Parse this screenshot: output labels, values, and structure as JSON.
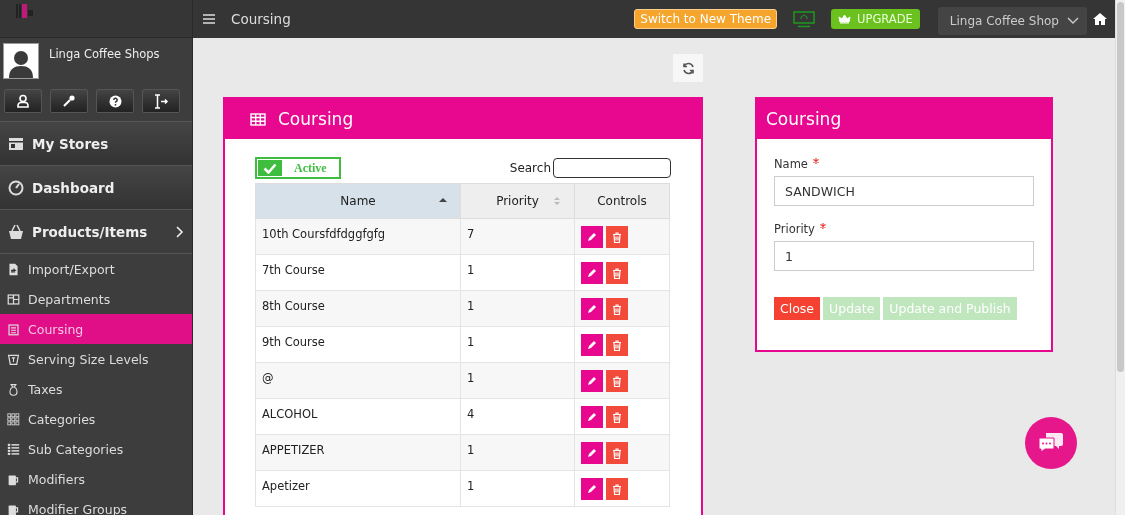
{
  "topbar": {
    "title": "Coursing",
    "theme_button": "Switch to New Theme",
    "upgrade_button": "UPGRADE",
    "store_selector": "Linga Coffee Shop"
  },
  "profile": {
    "name": "Linga Coffee Shops"
  },
  "sidebar": {
    "items": [
      {
        "label": "My Stores",
        "kind": "main",
        "selected": false
      },
      {
        "label": "Dashboard",
        "kind": "main",
        "selected": false
      },
      {
        "label": "Products/Items",
        "kind": "group",
        "selected": false,
        "expanded": true
      },
      {
        "label": "Import/Export",
        "kind": "sub",
        "selected": false
      },
      {
        "label": "Departments",
        "kind": "sub",
        "selected": false
      },
      {
        "label": "Coursing",
        "kind": "sub",
        "selected": true
      },
      {
        "label": "Serving Size Levels",
        "kind": "sub",
        "selected": false
      },
      {
        "label": "Taxes",
        "kind": "sub",
        "selected": false
      },
      {
        "label": "Categories",
        "kind": "sub",
        "selected": false
      },
      {
        "label": "Sub Categories",
        "kind": "sub",
        "selected": false
      },
      {
        "label": "Modifiers",
        "kind": "sub",
        "selected": false
      },
      {
        "label": "Modifier Groups",
        "kind": "sub",
        "selected": false
      }
    ]
  },
  "list_panel": {
    "title": "Coursing",
    "active_filter": {
      "label": "Active",
      "checked": true
    },
    "search": {
      "label": "Search"
    },
    "table": {
      "columns": [
        {
          "label": "Name",
          "sortable": true,
          "sorted": true
        },
        {
          "label": "Priority",
          "sortable": true,
          "sorted": false
        },
        {
          "label": "Controls",
          "sortable": false,
          "sorted": false
        }
      ],
      "rows": [
        {
          "name": "10th Coursfdfdggfgfg",
          "priority": "7"
        },
        {
          "name": "7th Course",
          "priority": "1"
        },
        {
          "name": "8th Course",
          "priority": "1"
        },
        {
          "name": "9th Course",
          "priority": "1"
        },
        {
          "name": "@",
          "priority": "1"
        },
        {
          "name": "ALCOHOL",
          "priority": "4"
        },
        {
          "name": "APPETIZER",
          "priority": "1"
        },
        {
          "name": "Apetizer",
          "priority": "1"
        }
      ]
    }
  },
  "form_panel": {
    "title": "Coursing",
    "fields": [
      {
        "label": "Name",
        "required": true,
        "value": "SANDWICH"
      },
      {
        "label": "Priority",
        "required": true,
        "value": "1"
      }
    ],
    "buttons": [
      {
        "label": "Close",
        "kind": "danger",
        "disabled": false
      },
      {
        "label": "Update",
        "kind": "success",
        "disabled": true
      },
      {
        "label": "Update and Publish",
        "kind": "success",
        "disabled": true
      }
    ]
  }
}
